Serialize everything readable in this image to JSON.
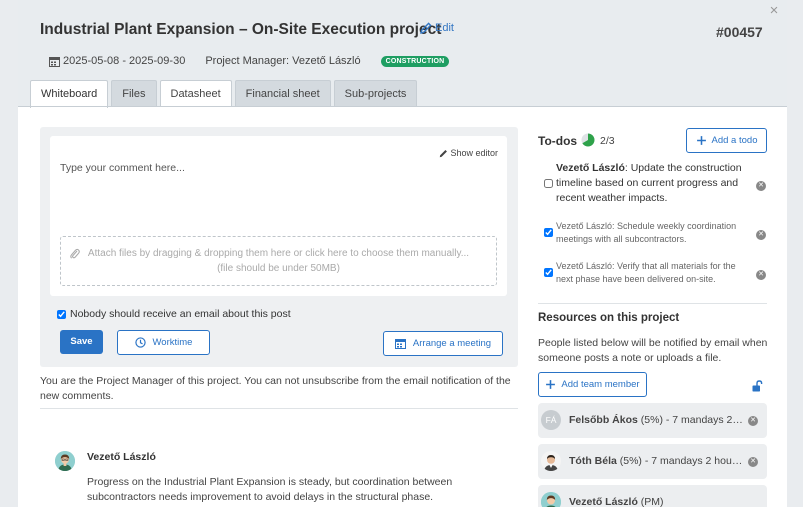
{
  "header": {
    "title": "Industrial Plant Expansion – On-Site Execution project",
    "edit_label": "Edit",
    "project_id": "#00457",
    "date_range": "2025-05-08 - 2025-09-30",
    "project_manager": "Project Manager: Vezető László",
    "status_badge": "CONSTRUCTION",
    "close_symbol": "×"
  },
  "tabs": [
    {
      "label": "Whiteboard",
      "active": true
    },
    {
      "label": "Files",
      "active": false
    },
    {
      "label": "Datasheet",
      "active": false
    },
    {
      "label": "Financial sheet",
      "active": false
    },
    {
      "label": "Sub-projects",
      "active": false
    }
  ],
  "comment": {
    "show_editor_label": "Show editor",
    "placeholder": "Type your comment here...",
    "attach_text": "Attach files by dragging & dropping them here or click here to choose them manually...",
    "attach_limit": "(file should be under 50MB)",
    "no_email_label": "Nobody should receive an email about this post",
    "no_email_checked": true,
    "save_label": "Save",
    "worktime_label": "Worktime",
    "meeting_label": "Arrange a meeting"
  },
  "pm_note": "You are the Project Manager of this project. You can not unsubscribe from the email notification of the new comments.",
  "post": {
    "author": "Vezető László",
    "text": "Progress on the Industrial Plant Expansion is steady, but coordination between subcontractors needs improvement to avoid delays in the structural phase."
  },
  "todos": {
    "title": "To-dos",
    "count": "2/3",
    "completed_fraction": 0.6667,
    "add_label": "Add a todo",
    "items": [
      {
        "author": "Vezető László",
        "text": ": Update the construction timeline based on current progress and recent weather impacts.",
        "done": false
      },
      {
        "author": "Vezető László",
        "text": ": Schedule weekly coordination meetings with all subcontractors.",
        "done": true
      },
      {
        "author": "Vezető László",
        "text": ": Verify that all materials for the next phase have been delivered on-site.",
        "done": true
      }
    ]
  },
  "resources": {
    "title": "Resources on this project",
    "note": "People listed below will be notified by email when someone posts a note or uploads a file.",
    "add_member_label": "Add team member",
    "members": [
      {
        "initials": "FÁ",
        "name": "Felsőbb Ákos",
        "detail": " (5%) - 7 mandays 2 h..."
      },
      {
        "initials": "",
        "name": "Tóth Béla",
        "detail": " (5%) - 7 mandays 2 hour 2..."
      },
      {
        "initials": "",
        "name": "Vezető László",
        "detail": " (PM)"
      }
    ]
  },
  "colors": {
    "accent": "#2a73c5",
    "badge": "#1e9e62",
    "progress": "#2ea24a",
    "header_bg": "#e8ecef"
  }
}
